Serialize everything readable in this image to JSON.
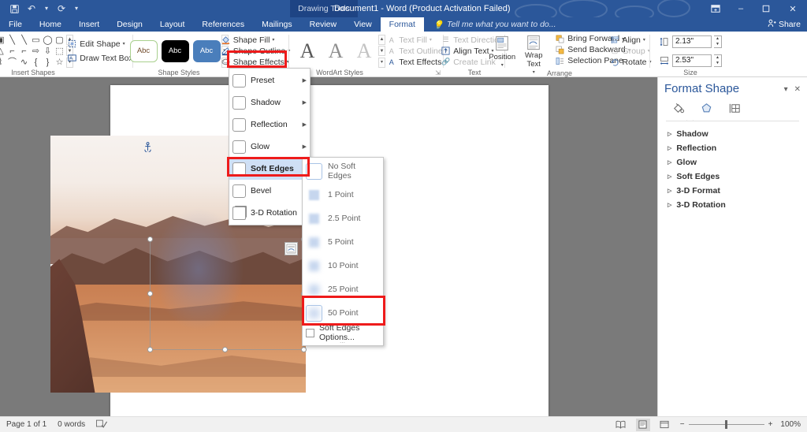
{
  "titlebar": {
    "quick_access": [
      {
        "name": "save-icon",
        "glyph": "💾"
      },
      {
        "name": "undo-icon",
        "glyph": "↶"
      },
      {
        "name": "redo-icon",
        "glyph": "↻"
      },
      {
        "name": "customize-qat-icon",
        "glyph": "▾"
      }
    ],
    "contextual_tab_label": "Drawing Tools",
    "document_title": "Document1 - Word (Product Activation Failed)",
    "window_buttons": [
      {
        "name": "ribbon-display-options-icon",
        "glyph": "⬚"
      },
      {
        "name": "minimize-icon",
        "glyph": "–"
      },
      {
        "name": "restore-icon",
        "glyph": "❐"
      },
      {
        "name": "close-icon",
        "glyph": "✕"
      }
    ]
  },
  "tabs": [
    {
      "label": "File",
      "active": false
    },
    {
      "label": "Home",
      "active": false
    },
    {
      "label": "Insert",
      "active": false
    },
    {
      "label": "Design",
      "active": false
    },
    {
      "label": "Layout",
      "active": false
    },
    {
      "label": "References",
      "active": false
    },
    {
      "label": "Mailings",
      "active": false
    },
    {
      "label": "Review",
      "active": false
    },
    {
      "label": "View",
      "active": false
    },
    {
      "label": "Format",
      "active": true
    }
  ],
  "tellme": {
    "placeholder": "Tell me what you want to do...",
    "icon": "lightbulb-icon"
  },
  "share": {
    "label": "Share",
    "icon": "share-person-icon"
  },
  "ribbon": {
    "groups": [
      {
        "name": "insert-shapes",
        "label": "Insert Shapes"
      },
      {
        "name": "shape-styles",
        "label": "Shape Styles"
      },
      {
        "name": "wordart-styles",
        "label": "WordArt Styles"
      },
      {
        "name": "text",
        "label": "Text"
      },
      {
        "name": "arrange",
        "label": "Arrange"
      },
      {
        "name": "size",
        "label": "Size"
      }
    ],
    "insert_shapes": {
      "shapes": [
        "▣",
        "╲",
        "╲",
        "▭",
        "◯",
        "▢",
        "△",
        "⌐",
        "⌐",
        "⇨",
        "⇩",
        "⬚",
        "⌇",
        "⌒",
        "∿",
        "{",
        "}",
        "☆"
      ],
      "edit_shape": "Edit Shape",
      "draw_text_box": "Draw Text Box"
    },
    "shape_styles": {
      "thumbs": [
        "Abc",
        "Abc",
        "Abc"
      ],
      "shape_fill": "Shape Fill",
      "shape_outline": "Shape Outline",
      "shape_effects": "Shape Effects"
    },
    "wordart_styles": {
      "thumbs": [
        "A",
        "A",
        "A"
      ],
      "text_fill": "Text Fill",
      "text_outline": "Text Outline",
      "text_effects": "Text Effects"
    },
    "text_group": {
      "text_direction": "Text Direction",
      "align_text": "Align Text",
      "create_link": "Create Link"
    },
    "arrange": {
      "position": "Position",
      "wrap_text": "Wrap Text",
      "bring_forward": "Bring Forward",
      "send_backward": "Send Backward",
      "selection_pane": "Selection Pane",
      "align": "Align",
      "group": "Group",
      "rotate": "Rotate"
    },
    "size": {
      "height_value": "2.13\"",
      "width_value": "2.53\"",
      "height_icon": "shape-height-icon",
      "width_icon": "shape-width-icon"
    }
  },
  "shape_effects_menu": {
    "items": [
      {
        "label": "Preset",
        "underline": "P",
        "icon": "preset-effect-icon",
        "selected": false
      },
      {
        "label": "Shadow",
        "underline": "S",
        "icon": "shadow-effect-icon",
        "selected": false
      },
      {
        "label": "Reflection",
        "underline": "R",
        "icon": "reflection-effect-icon",
        "selected": false
      },
      {
        "label": "Glow",
        "underline": "G",
        "icon": "glow-effect-icon",
        "selected": false
      },
      {
        "label": "Soft Edges",
        "underline": "E",
        "icon": "soft-edges-effect-icon",
        "selected": true
      },
      {
        "label": "Bevel",
        "underline": "B",
        "icon": "bevel-effect-icon",
        "selected": false
      },
      {
        "label": "3-D Rotation",
        "underline": "D",
        "icon": "rotation-3d-effect-icon",
        "selected": false
      }
    ]
  },
  "soft_edges_submenu": {
    "items": [
      {
        "label": "No Soft Edges",
        "blur": "none",
        "framed": true,
        "highlighted": false
      },
      {
        "label": "1 Point",
        "blur": "b1",
        "framed": false,
        "highlighted": false
      },
      {
        "label": "2.5 Point",
        "blur": "b2",
        "framed": false,
        "highlighted": false
      },
      {
        "label": "5 Point",
        "blur": "b3",
        "framed": false,
        "highlighted": false
      },
      {
        "label": "10 Point",
        "blur": "b4",
        "framed": false,
        "highlighted": false
      },
      {
        "label": "25 Point",
        "blur": "b5",
        "framed": false,
        "highlighted": false
      },
      {
        "label": "50 Point",
        "blur": "b6",
        "framed": true,
        "highlighted": true
      }
    ],
    "options_label": "Soft Edges Options...",
    "options_underline": "S"
  },
  "format_shape_pane": {
    "title": "Format Shape",
    "pane_menu_icon": "pane-options-icon",
    "close_icon": "close-icon",
    "tabs": [
      {
        "name": "fill-and-line-tab",
        "icon": "paint-bucket-icon",
        "active": false
      },
      {
        "name": "effects-tab",
        "icon": "pentagon-effects-icon",
        "active": true
      },
      {
        "name": "layout-properties-tab",
        "icon": "layout-properties-icon",
        "active": false
      }
    ],
    "sections": [
      "Shadow",
      "Reflection",
      "Glow",
      "Soft Edges",
      "3-D Format",
      "3-D Rotation"
    ]
  },
  "document": {
    "anchor_icon": "object-anchor-icon",
    "layout_options_icon": "layout-options-icon",
    "image_alt": "Mars landscape photo with soft edges applied"
  },
  "status_bar": {
    "page_info": "Page 1 of 1",
    "word_count": "0 words",
    "proofing_icon": "proofing-status-icon",
    "views": [
      {
        "name": "read-mode-view-button",
        "glyph": "📖",
        "active": false
      },
      {
        "name": "print-layout-view-button",
        "glyph": "▤",
        "active": true
      },
      {
        "name": "web-layout-view-button",
        "glyph": "⬚",
        "active": false
      }
    ],
    "zoom_out": "−",
    "zoom_in": "+",
    "zoom_level": "100%"
  },
  "colors": {
    "brand_blue": "#2b579a",
    "annotation_red": "#ee1b1b",
    "menu_highlight": "#cfdff5"
  }
}
